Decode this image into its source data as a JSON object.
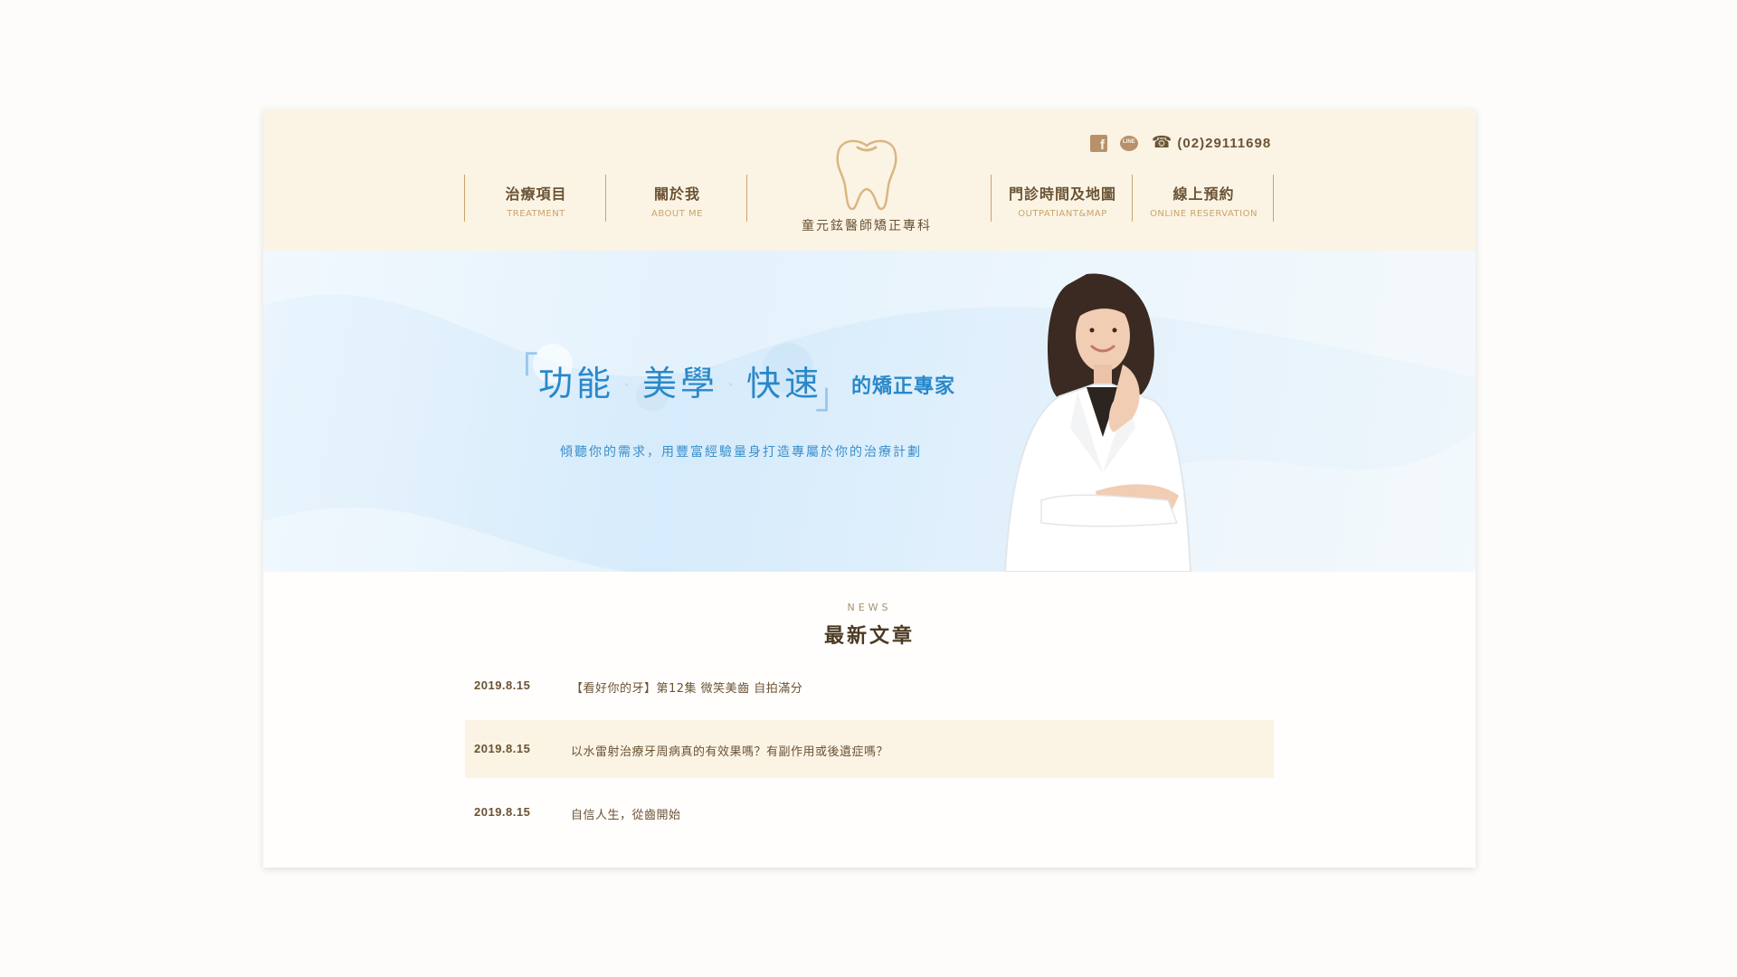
{
  "header": {
    "nav_left": [
      {
        "zh": "治療項目",
        "en": "TREATMENT"
      },
      {
        "zh": "關於我",
        "en": "ABOUT ME"
      }
    ],
    "nav_right": [
      {
        "zh": "門診時間及地圖",
        "en": "OUTPATIANT&MAP"
      },
      {
        "zh": "線上預約",
        "en": "ONLINE RESERVATION"
      }
    ],
    "logo_name": "童元鉉醫師矯正專科",
    "contact": {
      "facebook_icon": "facebook-icon",
      "line_icon": "line-icon",
      "phone_icon": "phone-icon",
      "line_label": "LINE",
      "phone": "(02)29111698"
    }
  },
  "banner": {
    "open_bracket": "「",
    "close_bracket": "」",
    "headline_words": [
      "功能",
      "美學",
      "快速"
    ],
    "headline_dot": "·",
    "headline_suffix": "的矯正專家",
    "subline": "傾聽你的需求，用豐富經驗量身打造專屬於你的治療計劃"
  },
  "news": {
    "label_en": "NEWS",
    "title": "最新文章",
    "items": [
      {
        "date": "2019.8.15",
        "title": "【看好你的牙】第12集 微笑美齒 自拍滿分"
      },
      {
        "date": "2019.8.15",
        "title": "以水雷射治療牙周病真的有效果嗎？有副作用或後遺症嗎？"
      },
      {
        "date": "2019.8.15",
        "title": "自信人生，從齒開始"
      }
    ]
  },
  "colors": {
    "header_bg": "#fbf4e5",
    "brand_brown": "#6b5334",
    "gold": "#c9a46b",
    "headline_blue": "#2a88c9"
  }
}
